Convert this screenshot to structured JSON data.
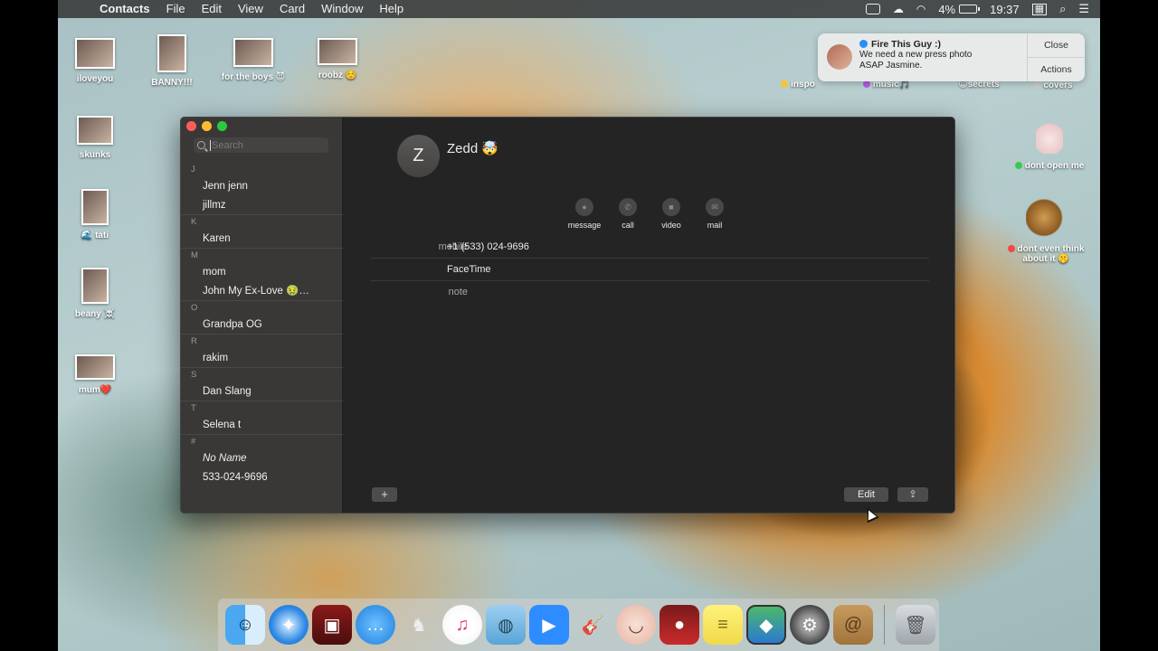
{
  "menubar": {
    "app_name": "Contacts",
    "menus": [
      "File",
      "Edit",
      "View",
      "Card",
      "Window",
      "Help"
    ],
    "battery": "4%",
    "time": "19:37"
  },
  "desktop_icons": [
    {
      "label": "iloveyou"
    },
    {
      "label": "BANNY!!!"
    },
    {
      "label": "for the boys 😈"
    },
    {
      "label": "roobz ☺️"
    },
    {
      "label": "skunks"
    },
    {
      "label": "🌊 tati"
    },
    {
      "label": "beany ☠️"
    },
    {
      "label": "mum❤️"
    },
    {
      "label": "inspo"
    },
    {
      "label": "music🎵"
    },
    {
      "label": "😇secrets"
    },
    {
      "label": "covers"
    },
    {
      "label": "dont open me"
    },
    {
      "label": "dont even think about it 🤫"
    }
  ],
  "notification": {
    "title": "Fire This Guy :)",
    "message": "We need a new press photo ASAP Jasmine.",
    "close_label": "Close",
    "actions_label": "Actions"
  },
  "sidebar": {
    "search_placeholder": "Search",
    "sections": [
      {
        "letter": "J",
        "contacts": [
          "Jenn jenn",
          "jillmz"
        ]
      },
      {
        "letter": "K",
        "contacts": [
          "Karen"
        ]
      },
      {
        "letter": "M",
        "contacts": [
          "mom",
          "John My Ex-Love 🤢…"
        ]
      },
      {
        "letter": "O",
        "contacts": [
          "Grandpa OG"
        ]
      },
      {
        "letter": "R",
        "contacts": [
          "rakim"
        ]
      },
      {
        "letter": "S",
        "contacts": [
          "Dan Slang"
        ]
      },
      {
        "letter": "T",
        "contacts": [
          "Selena t"
        ]
      },
      {
        "letter": "#",
        "contacts": [
          "No Name",
          "533-024-9696"
        ]
      }
    ]
  },
  "detail": {
    "initial": "Z",
    "name": "Zedd 🤯",
    "actions": [
      {
        "label": "message",
        "icon": "message-icon"
      },
      {
        "label": "call",
        "icon": "phone-icon"
      },
      {
        "label": "video",
        "icon": "video-icon"
      },
      {
        "label": "mail",
        "icon": "mail-icon"
      }
    ],
    "fields": [
      {
        "label": "mobile",
        "value": "+1 (533) 024-9696"
      },
      {
        "label": "",
        "value": "FaceTime"
      },
      {
        "label": "note",
        "value": ""
      }
    ],
    "add_label": "+",
    "edit_label": "Edit"
  },
  "dock": {
    "apps": [
      "Finder",
      "Safari",
      "Photo Booth",
      "Messages",
      "Skitch",
      "iTunes",
      "Seal",
      "Zoom",
      "GarageBand",
      "Face",
      "Photo Booth 2",
      "Stickies",
      "Preview",
      "System Preferences",
      "Contacts",
      "Trash"
    ]
  }
}
